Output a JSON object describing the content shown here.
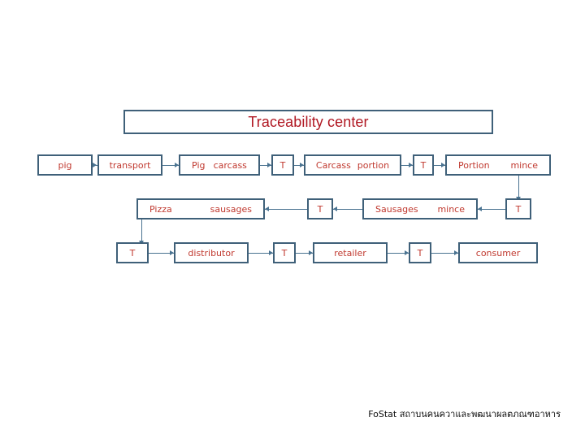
{
  "colors": {
    "box_border": "#3f6079",
    "connector": "#4a7391",
    "node_text": "#c0392f",
    "title_text": "#b01722",
    "background": "#ffffff",
    "footer_text": "#0d0d0d"
  },
  "title": {
    "text": "Traceability center"
  },
  "diagram": {
    "rows": [
      {
        "id": "row-1",
        "direction": "left-to-right",
        "nodes": [
          {
            "id": "pig",
            "labels": [
              "pig"
            ]
          },
          {
            "id": "transport",
            "labels": [
              "transport"
            ]
          },
          {
            "id": "pig-carcass",
            "labels": [
              "Pig",
              "carcass"
            ]
          },
          {
            "id": "t-1",
            "labels": [
              "T"
            ]
          },
          {
            "id": "carcass-portion",
            "labels": [
              "Carcass",
              "portion"
            ]
          },
          {
            "id": "t-2",
            "labels": [
              "T"
            ]
          },
          {
            "id": "portion-mince",
            "labels": [
              "Portion",
              "mince"
            ]
          }
        ]
      },
      {
        "id": "row-2",
        "direction": "right-to-left",
        "nodes": [
          {
            "id": "pizza-sausages",
            "labels": [
              "Pizza",
              "sausages"
            ]
          },
          {
            "id": "t-3",
            "labels": [
              "T"
            ]
          },
          {
            "id": "sausages-mince",
            "labels": [
              "Sausages",
              "mince"
            ]
          },
          {
            "id": "t-4",
            "labels": [
              "T"
            ]
          }
        ]
      },
      {
        "id": "row-3",
        "direction": "left-to-right",
        "nodes": [
          {
            "id": "t-5",
            "labels": [
              "T"
            ]
          },
          {
            "id": "distributor",
            "labels": [
              "distributor"
            ]
          },
          {
            "id": "t-6",
            "labels": [
              "T"
            ]
          },
          {
            "id": "retailer",
            "labels": [
              "retailer"
            ]
          },
          {
            "id": "t-7",
            "labels": [
              "T"
            ]
          },
          {
            "id": "consumer",
            "labels": [
              "consumer"
            ]
          }
        ]
      }
    ]
  },
  "footer": {
    "text": "FoStat  สถาบนคนควาและพฒนาผลตภณฑอาหาร"
  }
}
